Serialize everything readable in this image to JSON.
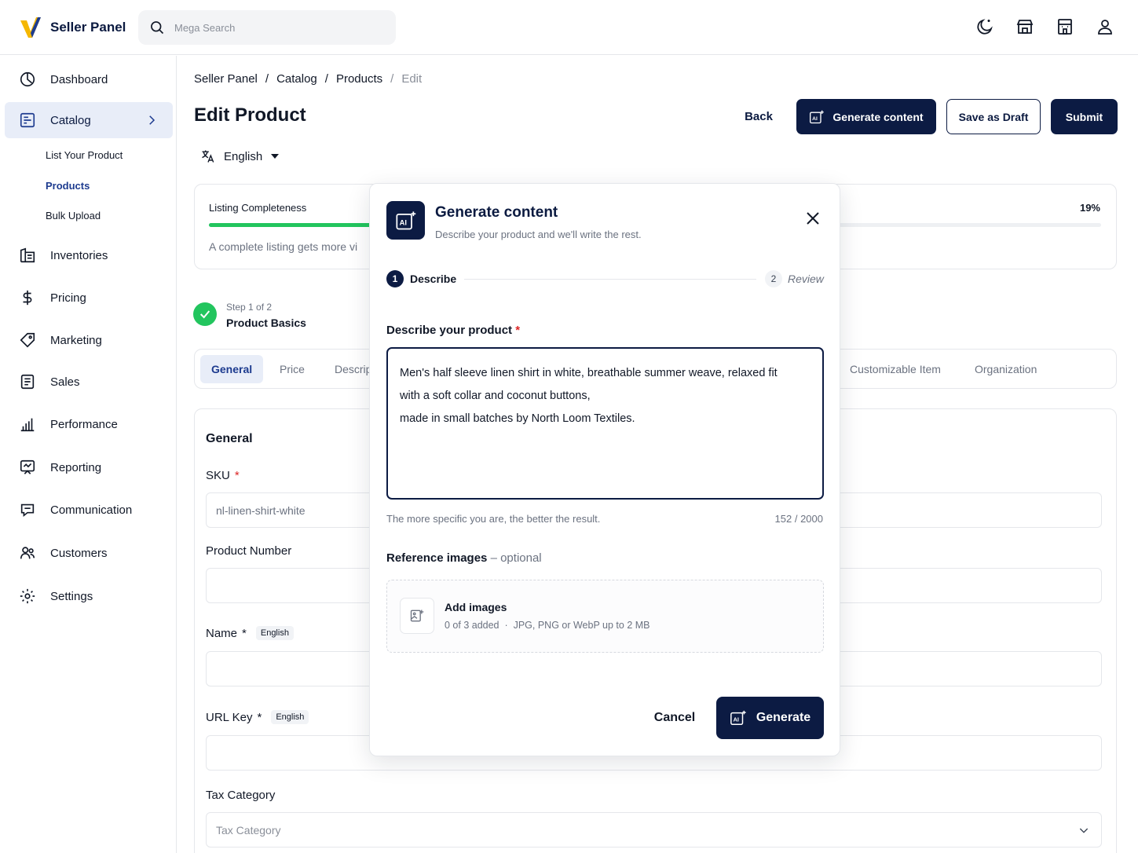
{
  "header": {
    "app_name": "Seller Panel",
    "search_placeholder": "Mega Search",
    "icons": [
      "theme-toggle-icon",
      "storefront-icon",
      "store-building-icon",
      "user-icon"
    ]
  },
  "sidebar": {
    "items": [
      {
        "label": "Dashboard",
        "icon": "dashboard-icon"
      },
      {
        "label": "Catalog",
        "icon": "catalog-icon",
        "active": true
      },
      {
        "label": "Inventories",
        "icon": "inventory-icon"
      },
      {
        "label": "Pricing",
        "icon": "dollar-icon"
      },
      {
        "label": "Marketing",
        "icon": "tag-icon"
      },
      {
        "label": "Sales",
        "icon": "sales-icon"
      },
      {
        "label": "Performance",
        "icon": "performance-icon"
      },
      {
        "label": "Reporting",
        "icon": "reporting-icon"
      },
      {
        "label": "Communication",
        "icon": "communication-icon"
      },
      {
        "label": "Customers",
        "icon": "customers-icon"
      },
      {
        "label": "Settings",
        "icon": "settings-icon"
      }
    ],
    "sub_items": [
      {
        "label": "List Your Product"
      },
      {
        "label": "Products",
        "active": true
      },
      {
        "label": "Bulk Upload"
      }
    ]
  },
  "breadcrumb": [
    "Seller Panel",
    "Catalog",
    "Products",
    "Edit"
  ],
  "page": {
    "title": "Edit Product",
    "back_label": "Back",
    "generate_label": "Generate content",
    "draft_label": "Save as Draft",
    "submit_label": "Submit",
    "language": "English"
  },
  "completeness": {
    "label": "Listing Completeness",
    "percent_text": "19%",
    "percent": 19,
    "hint": "A complete listing gets more vi"
  },
  "step": {
    "count": "Step 1 of 2",
    "name": "Product Basics"
  },
  "tabs": [
    "General",
    "Price",
    "Descrip",
    "Customizable Item",
    "Organization"
  ],
  "form": {
    "section_title": "General",
    "sku_label": "SKU",
    "sku_value": "nl-linen-shirt-white",
    "product_number_label": "Product Number",
    "name_label": "Name",
    "name_lang": "English",
    "url_key_label": "URL Key",
    "url_key_lang": "English",
    "tax_label": "Tax Category",
    "tax_placeholder": "Tax Category"
  },
  "modal": {
    "title": "Generate content",
    "subtitle": "Describe your product and we'll write the rest.",
    "step1_num": "1",
    "step1_label": "Describe",
    "step2_num": "2",
    "step2_label": "Review",
    "describe_label": "Describe your product",
    "description_lines": [
      "Men's half sleeve linen shirt in white, breathable summer weave, relaxed fit",
      "with a soft collar and coconut buttons,",
      "made in small batches by North Loom Textiles."
    ],
    "hint": "The more specific you are, the better the result.",
    "char_count": "152",
    "char_max": "2000",
    "ref_label": "Reference images",
    "ref_optional": "– optional",
    "add_images": "Add images",
    "images_added": "0 of 3 added",
    "formats": "JPG, PNG or WebP up to 2 MB",
    "cancel_label": "Cancel",
    "generate_label": "Generate"
  },
  "colors": {
    "brand_navy": "#0c1b43",
    "accent_green": "#22c55e",
    "required_red": "#dc2626",
    "logo_yellow": "#f5b700"
  }
}
